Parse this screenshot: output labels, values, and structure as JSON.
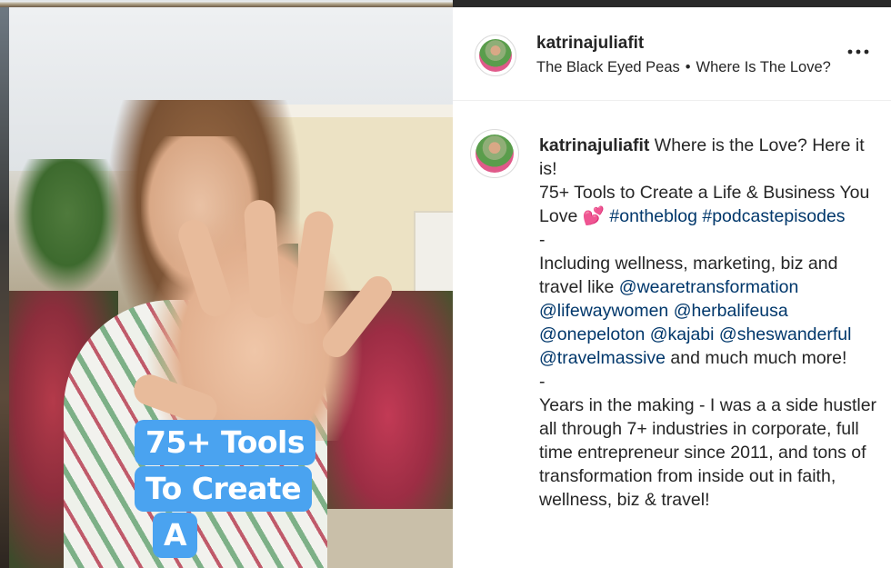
{
  "post": {
    "username": "katrinajuliafit",
    "audio": {
      "artist": "The Black Eyed Peas",
      "separator": "•",
      "song": "Where Is The Love?"
    },
    "more_icon": "more-horizontal-icon"
  },
  "media": {
    "overlay_lines": [
      "75+ Tools",
      "To Create",
      "A"
    ]
  },
  "caption": {
    "username": "katrinajuliafit",
    "line1": "Where is the Love? Here it is!",
    "line2": "75+ Tools to Create a Life & Business You Love",
    "emoji": "💕",
    "hashtag1": "#ontheblog",
    "hashtag2": "#podcastepisodes",
    "dash1": "-",
    "para2_intro": "Including wellness, marketing, biz and travel like",
    "mentions": [
      "@wearetransformation",
      "@lifewaywomen",
      "@herbalifeusa",
      "@onepeloton",
      "@kajabi",
      "@sheswanderful",
      "@travelmassive"
    ],
    "para2_end": "and much much more!",
    "dash2": "-",
    "para3": "Years in the making - I was a a side hustler all through 7+ industries in corporate, full time entrepreneur since 2011, and tons of transformation from inside out in faith, wellness, biz & travel!"
  },
  "colors": {
    "link": "#00376b",
    "text": "#262626",
    "overlay_bg": "#4aa3f0"
  }
}
